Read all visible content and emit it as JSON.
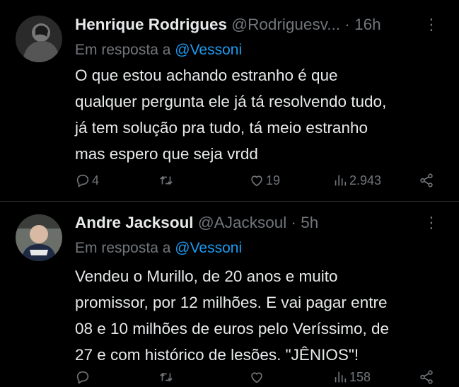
{
  "tweets": [
    {
      "name": "Henrique Rodrigues",
      "handle": "@Rodriguesv...",
      "separator": "·",
      "time": "16h",
      "reply_prefix": "Em resposta a",
      "reply_to": "@Vessoni",
      "lines": [
        "O que estou achando estranho é que",
        "qualquer pergunta ele já tá resolvendo tudo,",
        "já tem solução pra tudo, tá meio estranho",
        "mas espero que seja vrdd"
      ],
      "replies": "4",
      "retweets": "",
      "likes": "19",
      "views": "2.943"
    },
    {
      "name": "Andre Jacksoul",
      "handle": "@AJacksoul",
      "separator": "·",
      "time": "5h",
      "reply_prefix": "Em resposta a",
      "reply_to": "@Vessoni",
      "lines": [
        "Vendeu o Murillo, de 20 anos e muito",
        "promissor, por 12 milhões.  E vai pagar entre",
        "08 e 10 milhões de euros pelo Veríssimo, de",
        "27 e com histórico de lesões. \"JÊNIOS\"!"
      ],
      "replies": "",
      "retweets": "",
      "likes": "",
      "views": "158"
    }
  ],
  "icons": {
    "more": "more-vertical-icon",
    "reply": "reply-icon",
    "retweet": "retweet-icon",
    "like": "heart-icon",
    "views": "views-icon",
    "share": "share-icon"
  },
  "colors": {
    "background": "#000000",
    "text": "#e7e9ea",
    "muted": "#71767b",
    "link": "#1d9bf0",
    "divider": "#2f3336"
  }
}
